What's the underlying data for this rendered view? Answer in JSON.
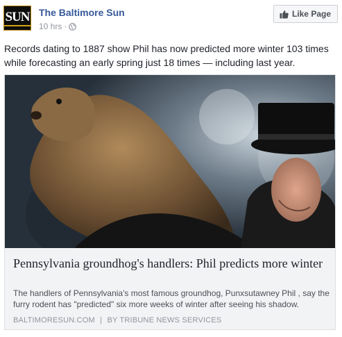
{
  "page": {
    "avatar_text": "SUN",
    "name": "The Baltimore Sun",
    "timestamp": "10 hrs",
    "separator": "·",
    "privacy_icon": "globe-icon"
  },
  "like_page": {
    "label": "Like Page",
    "icon": "thumbs-up-icon"
  },
  "post": {
    "text": "Records dating to 1887 show Phil has now predicted more winter 103 times while forecasting an early spring just 18 times — including last year."
  },
  "link": {
    "image_alt": "Groundhog held by handler in top hat",
    "title": "Pennsylvania groundhog's handlers: Phil predicts more winter",
    "description": "The handlers of Pennsylvania's most famous groundhog, Punxsutawney Phil , say the furry rodent has \"predicted\" six more weeks of winter after seeing his shadow.",
    "source": "BALTIMORESUN.COM",
    "source_separator": "|",
    "byline": "BY TRIBUNE NEWS SERVICES"
  },
  "colors": {
    "link_blue": "#365899",
    "meta_gray": "#90949c",
    "card_bg": "#f2f3f5"
  }
}
